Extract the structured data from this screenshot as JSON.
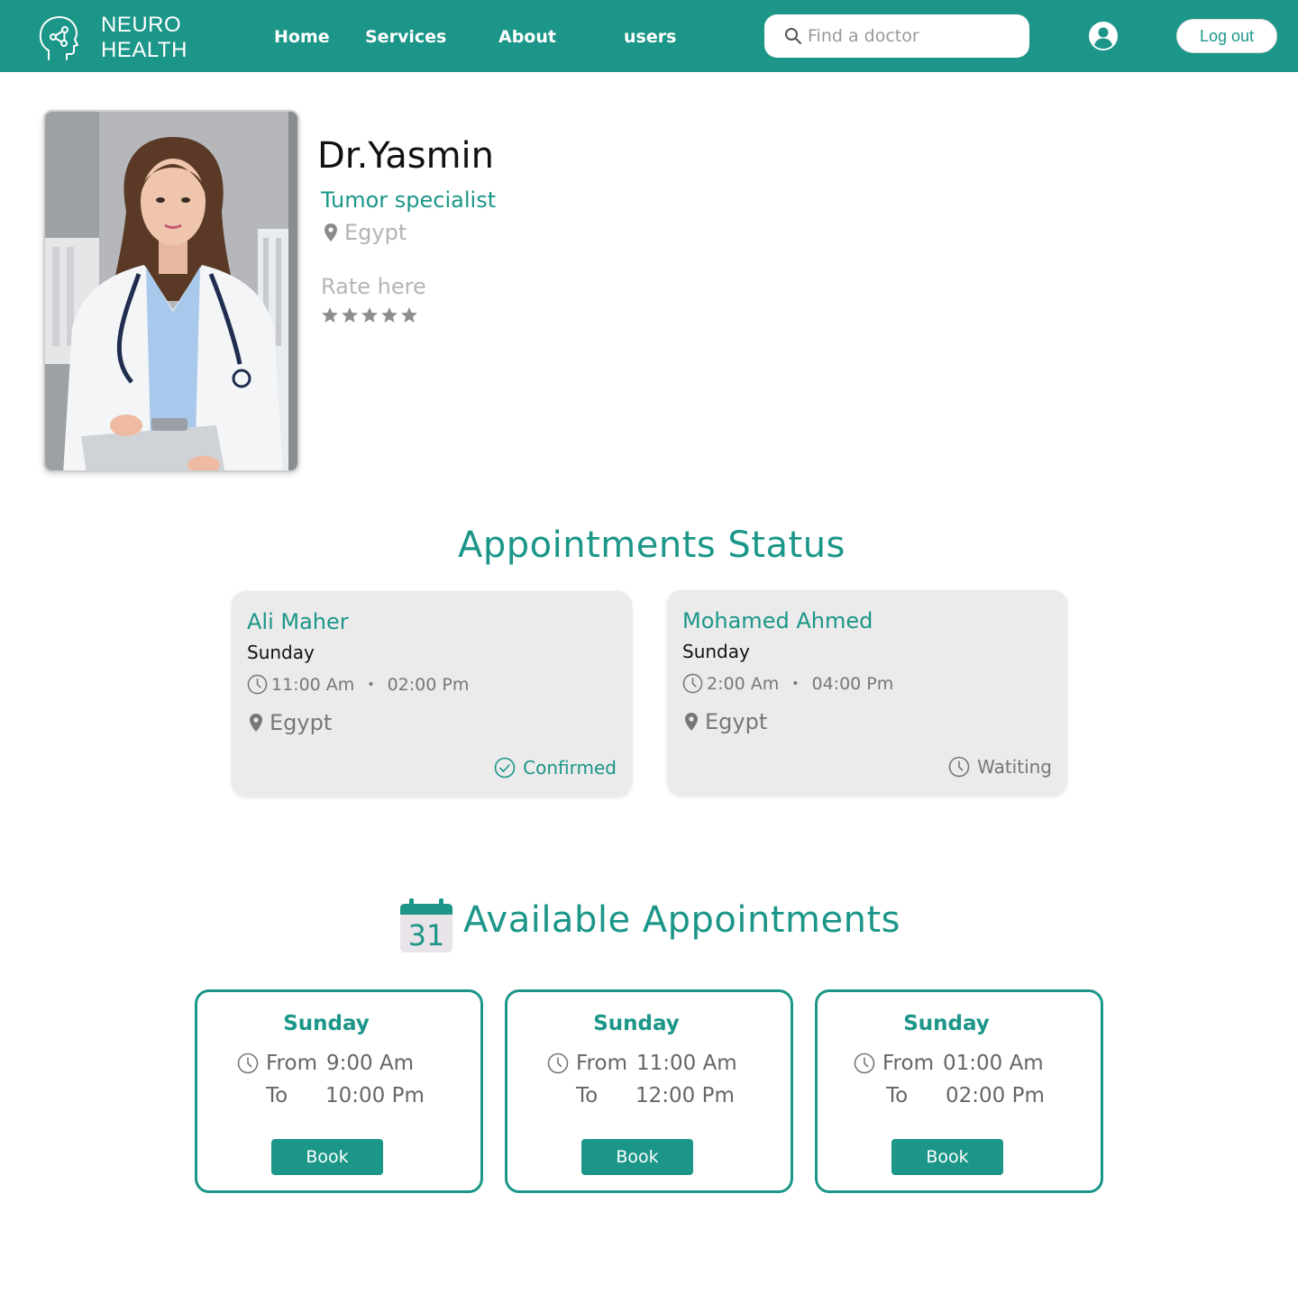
{
  "navbar": {
    "brand_line1": "NEURO",
    "brand_line2": "HEALTH",
    "links": [
      "Home",
      "Services",
      "About",
      "users"
    ],
    "search_placeholder": "Find a doctor",
    "logout_label": "Log out"
  },
  "profile": {
    "name": "Dr.Yasmin",
    "specialty": "Tumor specialist",
    "location": "Egypt",
    "rate_label": "Rate here",
    "stars": 5
  },
  "status_section": {
    "title": "Appointments Status",
    "cards": [
      {
        "name": "Ali Maher",
        "day": "Sunday",
        "from": "11:00 Am",
        "to": "02:00 Pm",
        "location": "Egypt",
        "status": "Confirmed",
        "status_color": "#1b9688"
      },
      {
        "name": "Mohamed Ahmed",
        "day": "Sunday",
        "from": "2:00 Am",
        "to": "04:00 Pm",
        "location": "Egypt",
        "status": "Watiting",
        "status_color": "#777777"
      }
    ]
  },
  "available_section": {
    "title": "Available Appointments",
    "calendar_day": "31",
    "cards": [
      {
        "day": "Sunday",
        "from_label": "From",
        "from": "9:00 Am",
        "to_label": "To",
        "to": "10:00 Pm",
        "button": "Book"
      },
      {
        "day": "Sunday",
        "from_label": "From",
        "from": "11:00 Am",
        "to_label": "To",
        "to": "12:00 Pm",
        "button": "Book"
      },
      {
        "day": "Sunday",
        "from_label": "From",
        "from": "01:00 Am",
        "to_label": "To",
        "to": "02:00 Pm",
        "button": "Book"
      }
    ]
  },
  "colors": {
    "primary": "#1b9688",
    "card_bg": "#ebebeb"
  }
}
